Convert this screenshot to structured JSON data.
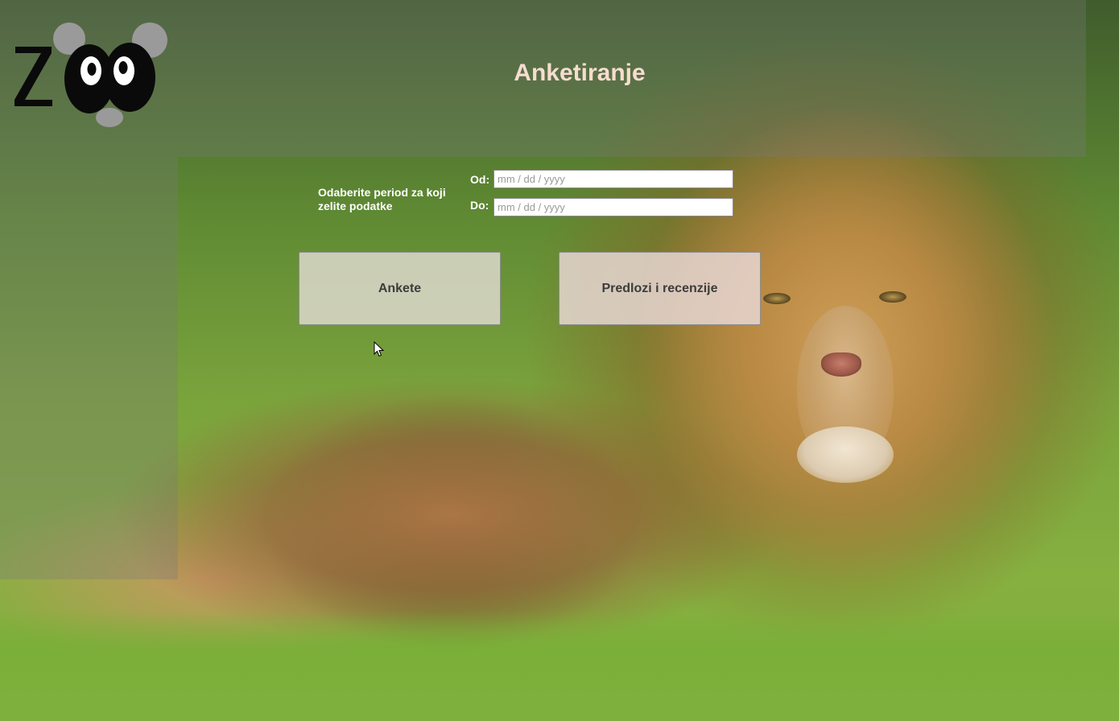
{
  "header": {
    "logo_text": "ZOO",
    "title": "Anketiranje"
  },
  "filter": {
    "period_label": "Odaberite period za koji zelite podatke",
    "from_label": "Od:",
    "from_placeholder": "mm / dd / yyyy",
    "to_label": "Do:",
    "to_placeholder": "mm / dd / yyyy"
  },
  "actions": {
    "surveys_label": "Ankete",
    "suggestions_label": "Predlozi i recenzije"
  },
  "icons": {
    "logo": "zoo-panda-logo-icon",
    "cursor": "mouse-pointer-icon"
  },
  "colors": {
    "title": "#f7dcd0",
    "overlay": "rgba(120,120,120,0.32)"
  }
}
